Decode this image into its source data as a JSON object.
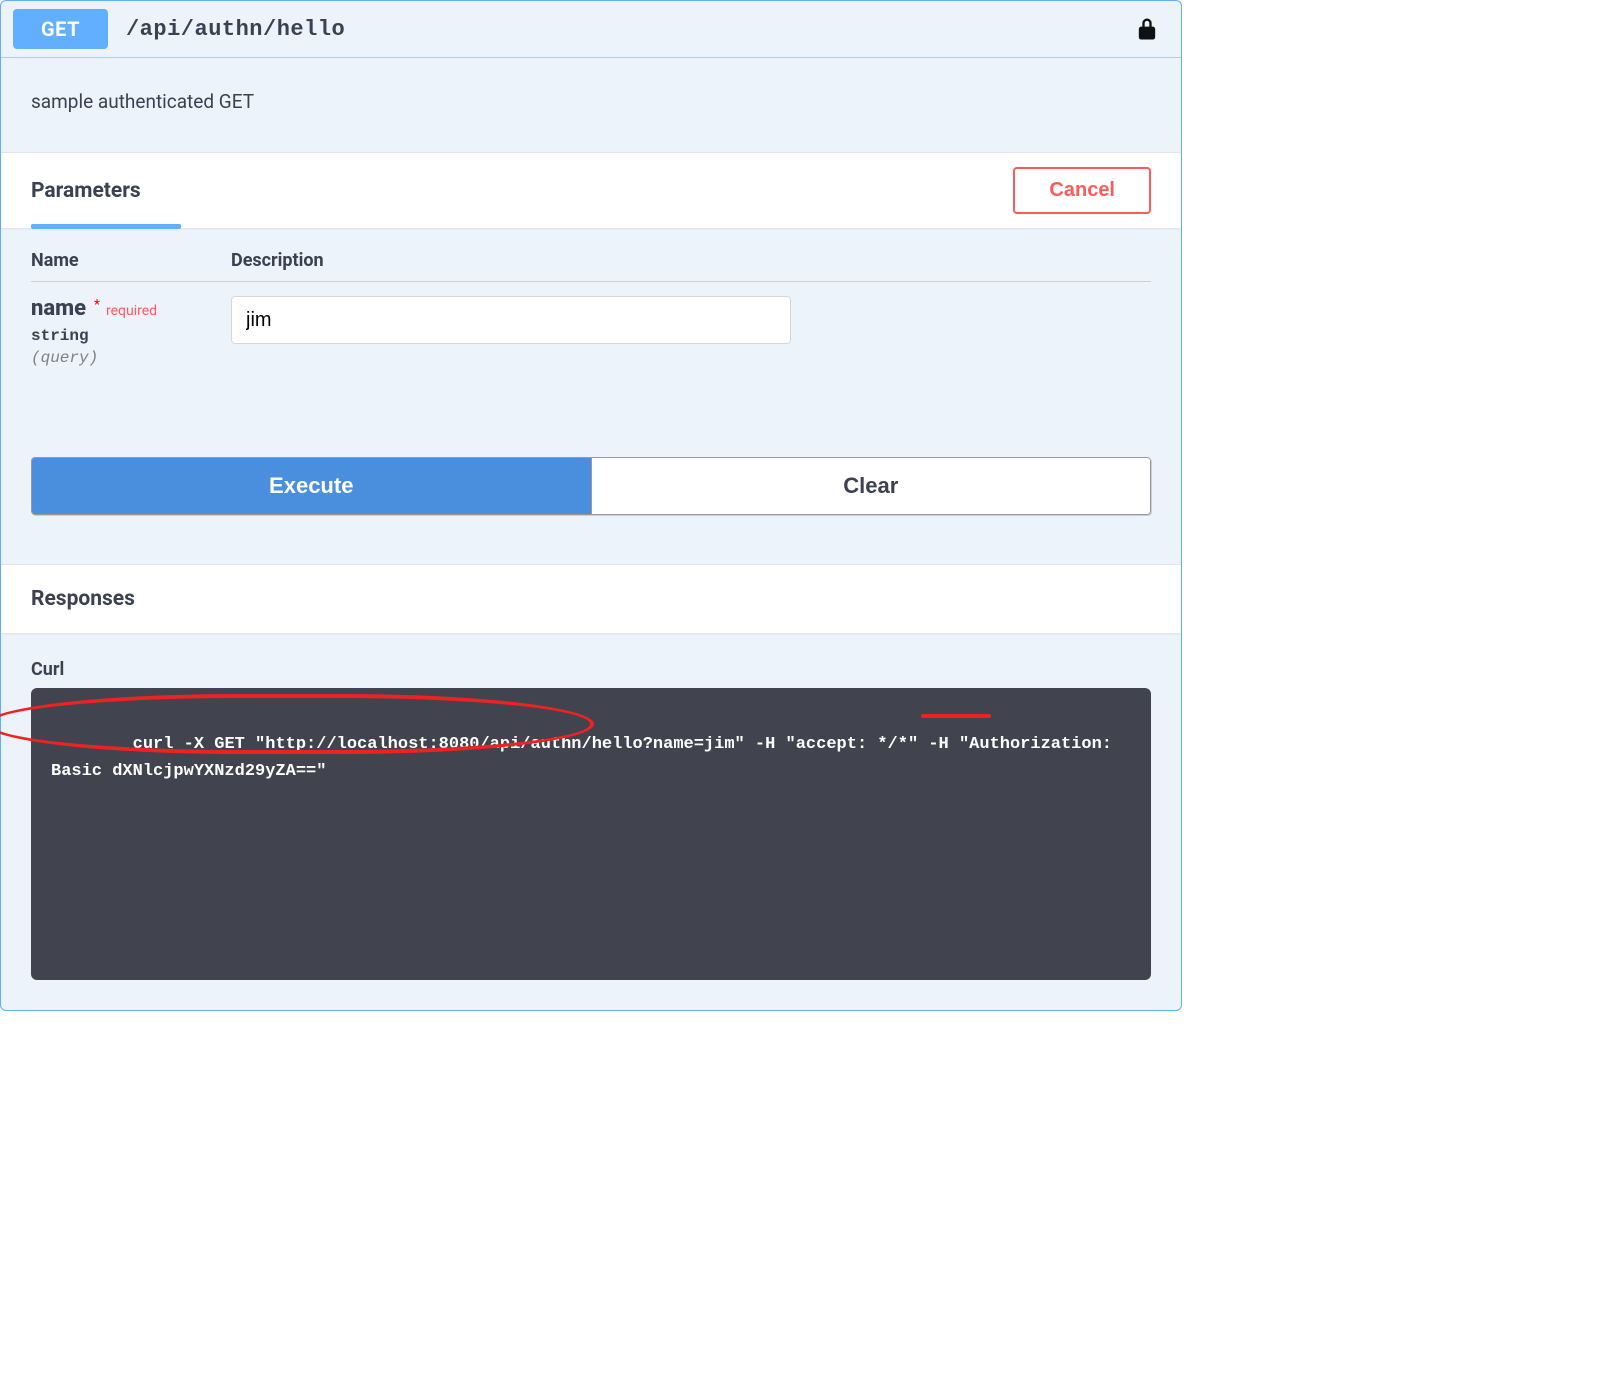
{
  "header": {
    "method": "GET",
    "path": "/api/authn/hello"
  },
  "summary": "sample authenticated GET",
  "parameters": {
    "title": "Parameters",
    "cancel_label": "Cancel",
    "columns": {
      "name": "Name",
      "description": "Description"
    },
    "items": [
      {
        "name": "name",
        "required_word": "required",
        "type": "string",
        "in_label": "(query)",
        "value": "jim"
      }
    ]
  },
  "actions": {
    "execute_label": "Execute",
    "clear_label": "Clear"
  },
  "responses": {
    "title": "Responses",
    "curl_title": "Curl",
    "curl_command": "curl -X GET \"http://localhost:8080/api/authn/hello?name=jim\" -H \"accept: */*\" -H \"Authorization: Basic dXNlcjpwYXNzd29yZA==\""
  }
}
